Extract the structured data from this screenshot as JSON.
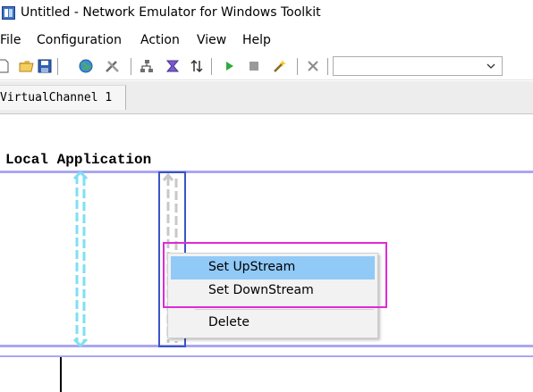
{
  "window": {
    "title": "Untitled - Network Emulator for Windows Toolkit"
  },
  "menu": [
    "File",
    "Configuration",
    "Action",
    "View",
    "Help"
  ],
  "toolbar": {
    "icons": [
      "new-icon",
      "open-icon",
      "save-icon",
      "globe-icon",
      "tools-icon",
      "network-icon",
      "filter-icon",
      "sort-icon",
      "play-icon",
      "stop-icon",
      "wand-icon",
      "close-icon"
    ],
    "combo_value": ""
  },
  "tabs": [
    {
      "label": "VirtualChannel 1"
    }
  ],
  "canvas": {
    "section_title": "Local Application"
  },
  "context_menu": {
    "items": [
      "Set UpStream",
      "Set DownStream",
      "Delete"
    ],
    "highlighted": "Set UpStream"
  },
  "colors": {
    "channel_line": "#aaa7f2",
    "arrow_cyan": "#7ee0f2",
    "arrow_gray": "#c8c8c8",
    "selection_blue": "#3a55c9",
    "highlight_magenta": "#e02ad6",
    "menu_highlight": "#91c9f7"
  }
}
